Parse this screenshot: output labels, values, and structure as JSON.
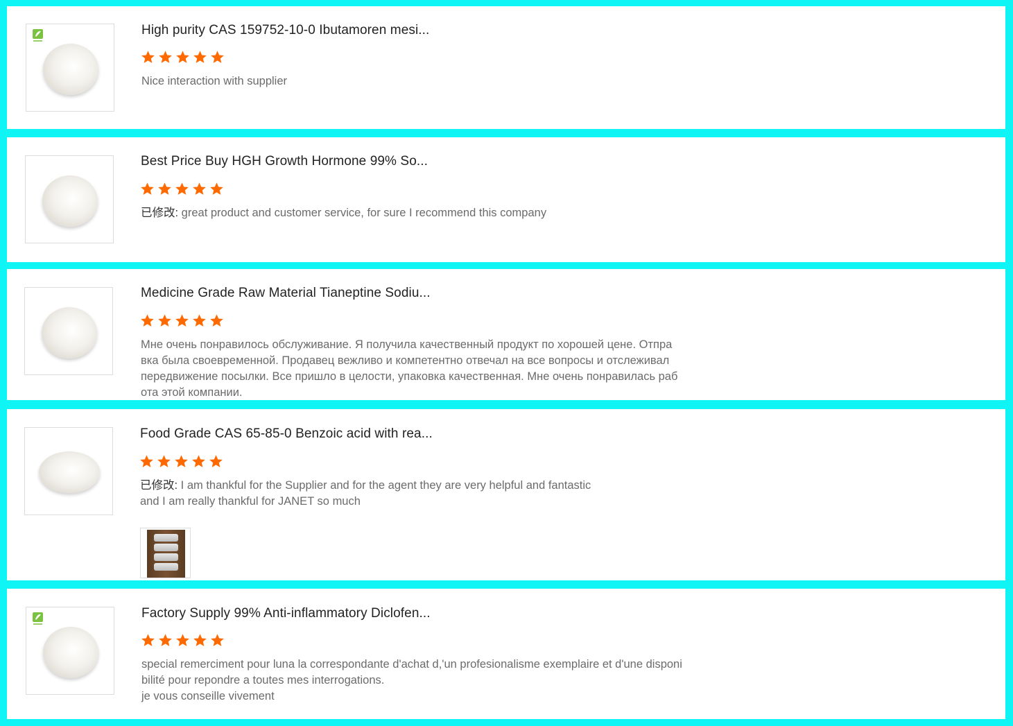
{
  "reviews": [
    {
      "title": "High purity CAS 159752-10-0 Ibutamoren mesi...",
      "rating": 5,
      "edited_prefix": "",
      "text": "Nice interaction with supplier",
      "has_logo": true,
      "has_photo": false
    },
    {
      "title": "Best Price Buy HGH Growth Hormone 99% So...",
      "rating": 5,
      "edited_prefix": "已修改:",
      "text": " great product and customer service, for sure I recommend this company",
      "has_logo": false,
      "has_photo": false
    },
    {
      "title": "Medicine Grade Raw Material Tianeptine Sodiu...",
      "rating": 5,
      "edited_prefix": "",
      "text": "Мне очень понравилось обслуживание. Я получила качественный продукт по хорошей цене. Отпра\nвка была своевременной. Продавец вежливо и компетентно отвечал на все вопросы и отслеживал\nпередвижение посылки. Все пришло в целости, упаковка качественная. Мне очень понравилась раб\nота этой компании.",
      "has_logo": false,
      "has_photo": false
    },
    {
      "title": "Food Grade CAS 65-85-0 Benzoic acid with rea...",
      "rating": 5,
      "edited_prefix": "已修改:",
      "text": " I am thankful for the Supplier and for the agent they are very helpful and fantastic\nand I am really thankful for JANET so much",
      "has_logo": false,
      "has_photo": true
    },
    {
      "title": "Factory Supply 99% Anti-inflammatory Diclofen...",
      "rating": 5,
      "edited_prefix": "",
      "text": "special remerciment pour luna la correspondante d'achat d,'un profesionalisme exemplaire et d'une disponi\nbilité pour repondre a toutes mes interrogations.\nje vous conseille vivement",
      "has_logo": true,
      "has_photo": false
    }
  ],
  "colors": {
    "background": "#0ff5f5",
    "star": "#ff6a00",
    "card": "#ffffff"
  },
  "icons": {
    "rating": "star-icon",
    "brand": "leaf-logo-icon"
  }
}
